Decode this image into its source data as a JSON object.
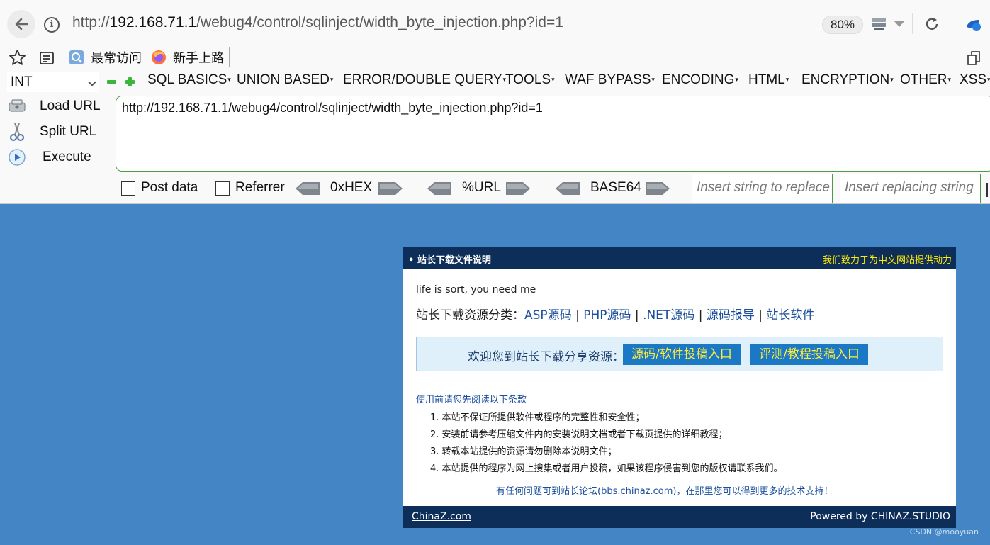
{
  "browser": {
    "url_prefix": "http://",
    "url_host": "192.168.71.1",
    "url_path": "/webug4/control/sqlinject/width_byte_injection.php?id=1",
    "zoom": "80%"
  },
  "bookmarks": {
    "most_visited": "最常访问",
    "getting_started": "新手上路"
  },
  "hackbar": {
    "type_value": "INT",
    "menu": [
      "SQL BASICS",
      "UNION BASED",
      "ERROR/DOUBLE QUERY",
      "TOOLS",
      "WAF BYPASS",
      "ENCODING",
      "HTML",
      "ENCRYPTION",
      "OTHER",
      "XSS"
    ],
    "load_url": "Load URL",
    "split_url": "Split URL",
    "execute": "Execute",
    "url_value": "http://192.168.71.1/webug4/control/sqlinject/width_byte_injection.php?id=1",
    "post_data": "Post data",
    "referrer": "Referrer",
    "hex": "0xHEX",
    "urlenc": "%URL",
    "base64": "BASE64",
    "insert_string": "Insert string to replace",
    "insert_replacing": "Insert replacing string"
  },
  "page": {
    "head_title": "• 站长下载文件说明",
    "head_slogan": "我们致力于为中文网站提供动力",
    "tagline": "life is sort, you need me",
    "cats_label": "站长下载资源分类：",
    "cats": [
      "ASP源码",
      "PHP源码",
      ".NET源码",
      "源码报导",
      "站长软件"
    ],
    "welcome": "欢迎您到站长下载分享资源：",
    "btn_submit": "源码/软件投稿入口",
    "btn_review": "评测/教程投稿入口",
    "terms_title": "使用前请您先阅读以下条款",
    "terms": [
      "1. 本站不保证所提供软件或程序的完整性和安全性；",
      "2. 安装前请参考压缩文件内的安装说明文档或者下载页提供的详细教程；",
      "3. 转载本站提供的资源请勿删除本说明文件；",
      "4. 本站提供的程序为网上搜集或者用户投稿，如果该程序侵害到您的版权请联系我们。"
    ],
    "forum": "有任何问题可到站长论坛(bbs.chinaz.com)，在那里您可以得到更多的技术支持！",
    "foot_left": "ChinaZ.com",
    "foot_right": "Powered by CHINAZ.STUDIO"
  },
  "watermark": "CSDN @mooyuan"
}
